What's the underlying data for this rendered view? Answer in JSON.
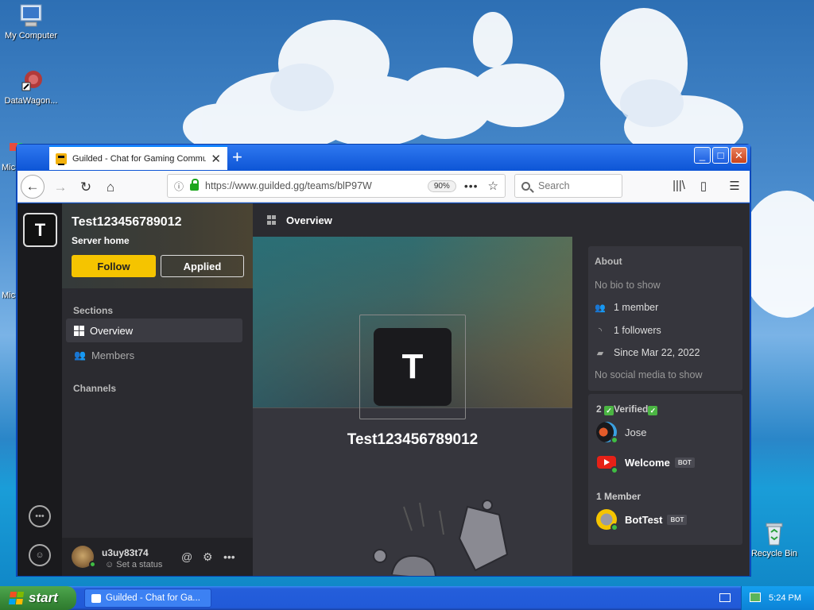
{
  "desktop": {
    "icons": [
      {
        "label": "My Computer",
        "icon": "computer-icon"
      },
      {
        "label": "DataWagon...",
        "icon": "shortcut-icon"
      },
      {
        "label": "Mic",
        "icon": "app-icon"
      },
      {
        "label": "Mic",
        "icon": "app-icon"
      },
      {
        "label": "Recycle Bin",
        "icon": "recycle-bin-icon"
      }
    ]
  },
  "browser": {
    "tab_title": "Guilded - Chat for Gaming Commu",
    "new_tab": "+",
    "url": "https://www.guilded.gg/teams/blP97W",
    "zoom": "90%",
    "search_placeholder": "Search",
    "window_buttons": {
      "minimize": "_",
      "maximize": "□",
      "close": "✕"
    }
  },
  "guilded": {
    "rail_team_letter": "T",
    "team_name": "Test123456789012",
    "server_home": "Server home",
    "follow_label": "Follow",
    "applied_label": "Applied",
    "sections_heading": "Sections",
    "nav": [
      {
        "label": "Overview",
        "active": true
      },
      {
        "label": "Members",
        "active": false
      }
    ],
    "channels_heading": "Channels",
    "user": {
      "name": "u3uy83t74",
      "status": "Set a status"
    },
    "main_header": "Overview",
    "avatar_letter": "T",
    "about": {
      "heading": "About",
      "bio": "No bio to show",
      "members": "1 member",
      "followers": "1 followers",
      "since": "Since Mar 22, 2022",
      "social": "No social media to show"
    },
    "verified_group": {
      "count": "2",
      "label": "Verified"
    },
    "verified_members": [
      {
        "name": "Jose",
        "bot": false
      },
      {
        "name": "Welcome",
        "bot": true
      }
    ],
    "member_group": {
      "count": "1",
      "label": "Member"
    },
    "members_list": [
      {
        "name": "BotTest",
        "bot": true
      }
    ],
    "bot_tag": "BOT"
  },
  "taskbar": {
    "start_label": "start",
    "task_item": "Guilded - Chat for Ga...",
    "clock": "5:24 PM"
  },
  "colors": {
    "accent_follow": "#f5c400",
    "online": "#3fbd43",
    "xp_blue": "#245edb"
  }
}
